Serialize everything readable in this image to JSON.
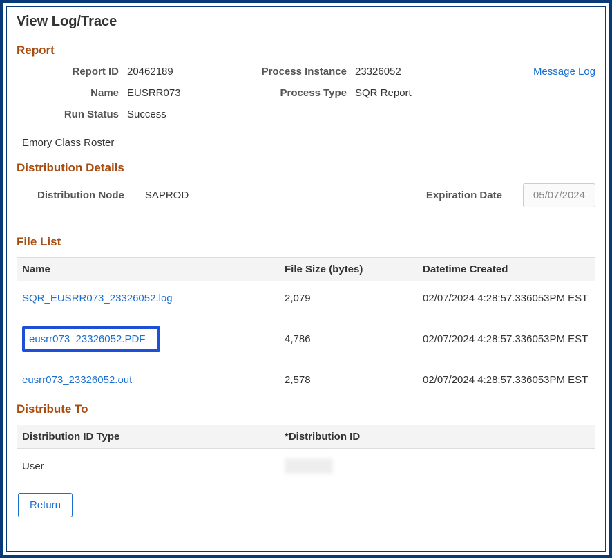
{
  "page_title": "View Log/Trace",
  "sections": {
    "report": "Report",
    "dist_details": "Distribution Details",
    "file_list": "File List",
    "distribute_to": "Distribute To"
  },
  "report": {
    "report_id_label": "Report ID",
    "report_id": "20462189",
    "name_label": "Name",
    "name": "EUSRR073",
    "run_status_label": "Run Status",
    "run_status": "Success",
    "process_instance_label": "Process Instance",
    "process_instance": "23326052",
    "process_type_label": "Process Type",
    "process_type": "SQR Report"
  },
  "message_log_link": "Message Log",
  "description": "Emory Class Roster",
  "distribution": {
    "node_label": "Distribution Node",
    "node": "SAPROD",
    "expiration_label": "Expiration Date",
    "expiration": "05/07/2024"
  },
  "file_list": {
    "headers": {
      "name": "Name",
      "size": "File Size (bytes)",
      "dt": "Datetime Created"
    },
    "rows": [
      {
        "name": "SQR_EUSRR073_23326052.log",
        "size": "2,079",
        "dt": "02/07/2024  4:28:57.336053PM EST",
        "highlight": false
      },
      {
        "name": "eusrr073_23326052.PDF",
        "size": "4,786",
        "dt": "02/07/2024  4:28:57.336053PM EST",
        "highlight": true
      },
      {
        "name": "eusrr073_23326052.out",
        "size": "2,578",
        "dt": "02/07/2024  4:28:57.336053PM EST",
        "highlight": false
      }
    ]
  },
  "distribute_to": {
    "headers": {
      "type": "Distribution ID Type",
      "id": "*Distribution ID"
    },
    "rows": [
      {
        "type": "User",
        "id": ""
      }
    ]
  },
  "return_label": "Return"
}
